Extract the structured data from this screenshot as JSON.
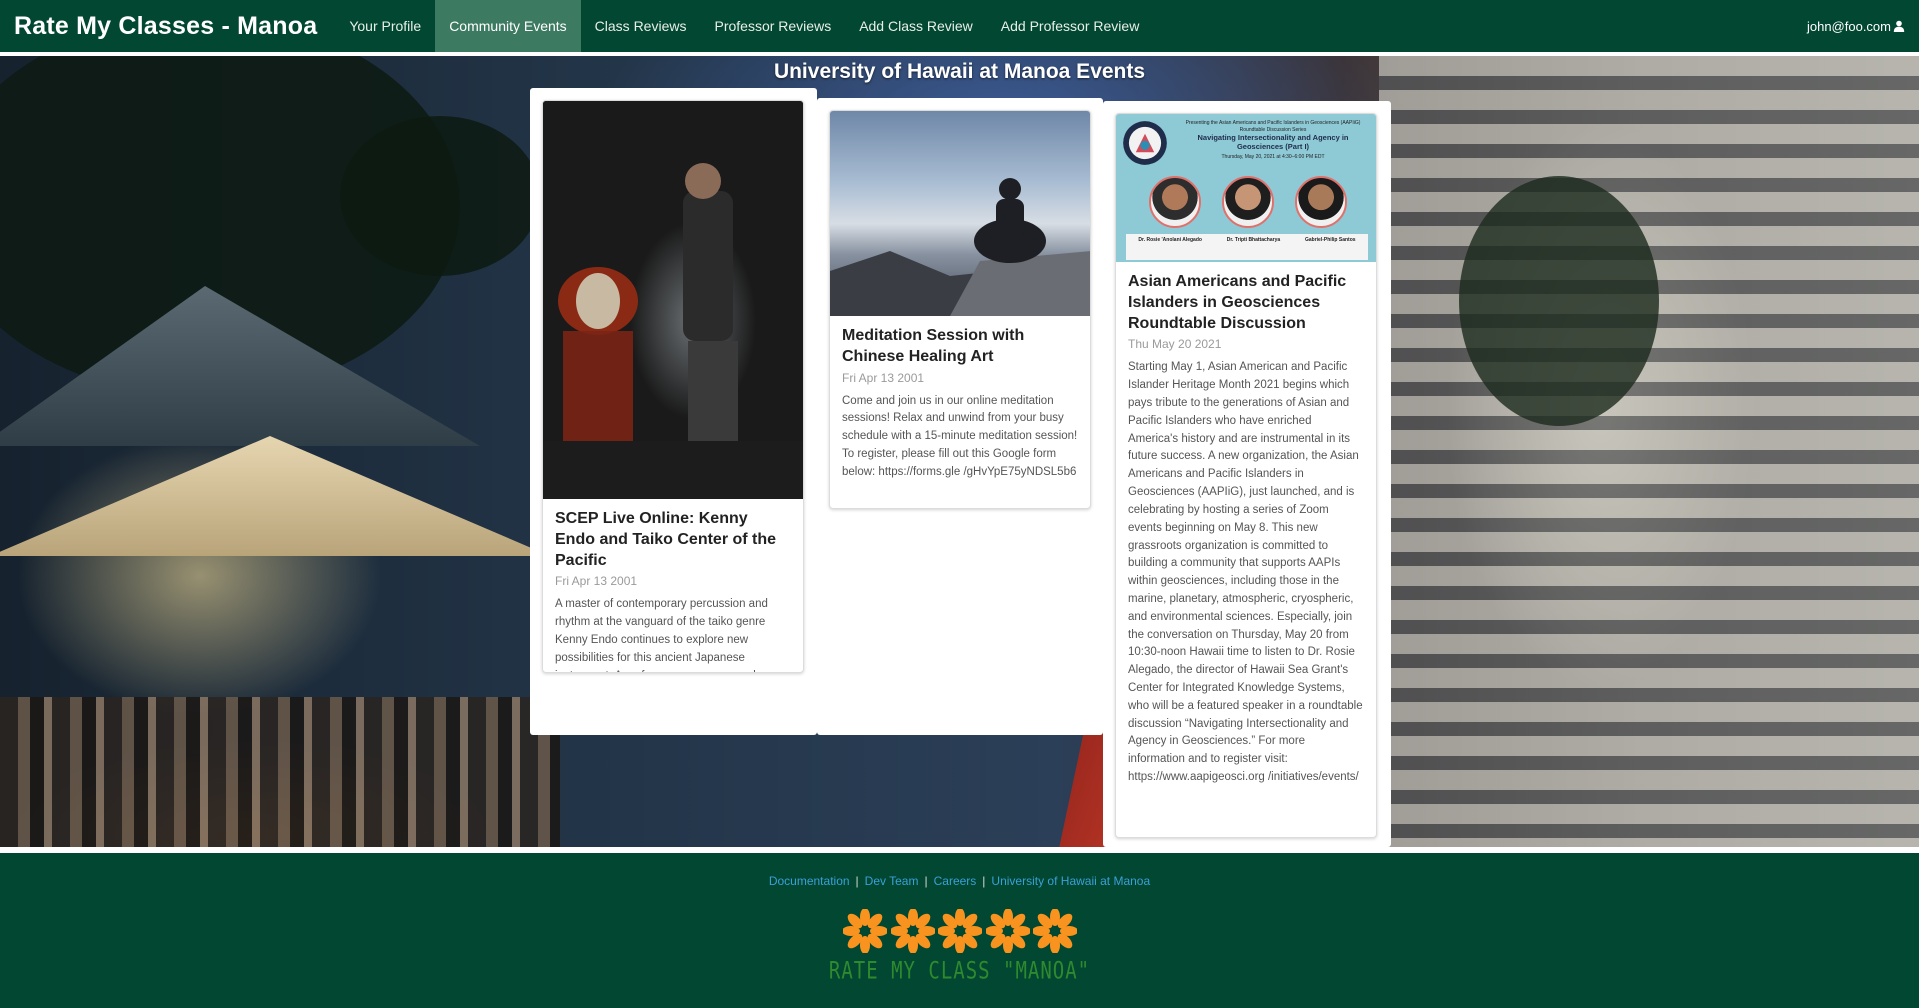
{
  "navbar": {
    "brand": "Rate My Classes - Manoa",
    "links": [
      {
        "label": "Your Profile",
        "active": false
      },
      {
        "label": "Community Events",
        "active": true
      },
      {
        "label": "Class Reviews",
        "active": false
      },
      {
        "label": "Professor Reviews",
        "active": false
      },
      {
        "label": "Add Class Review",
        "active": false
      },
      {
        "label": "Add Professor Review",
        "active": false
      }
    ],
    "user": "john@foo.com",
    "user_icon": "user-icon"
  },
  "hero": {
    "title": "University of Hawaii at Manoa Events"
  },
  "events": [
    {
      "title": "SCEP Live Online: Kenny Endo and Taiko Center of the Pacific",
      "date": "Fri Apr 13 2001",
      "description": "A master of contemporary percussion and rhythm at the vanguard of the taiko genre Kenny Endo continues to explore new possibilities for this ancient Japanese instrument. A performer, composer, and teacher of taiko, he has received numerous awards, accolades, and a natori (a stage name in classical drumming). Kenny is a consummate artist, blending taiko with original music through collaborations with international artists.",
      "image": "taiko-drummer-photo"
    },
    {
      "title": "Meditation Session with Chinese Healing Art",
      "date": "Fri Apr 13 2001",
      "description": "Come and join us in our online meditation sessions! Relax and unwind from your busy schedule with a 15-minute meditation session! To register, please fill out this Google form below: https://forms.gle /gHvYpE75yNDSL5b6",
      "image": "meditation-mountain-photo"
    },
    {
      "title": "Asian Americans and Pacific Islanders in Geosciences Roundtable Discussion",
      "date": "Thu May 20 2021",
      "description": "Starting May 1, Asian American and Pacific Islander Heritage Month 2021 begins which pays tribute to the generations of Asian and Pacific Islanders who have enriched America's history and are instrumental in its future success. A new organization, the Asian Americans and Pacific Islanders in Geosciences (AAPIiG), just launched, and is celebrating by hosting a series of Zoom events beginning on May 8. This new grassroots organization is committed to building a community that supports AAPIs within geosciences, including those in the marine, planetary, atmospheric, cryospheric, and environmental sciences. Especially, join the conversation on Thursday, May 20 from 10:30-noon Hawaii time to listen to Dr. Rosie Alegado, the director of Hawaii Sea Grant's Center for Integrated Knowledge Systems, who will be a featured speaker in a roundtable discussion “Navigating Intersectionality and Agency in Geosciences.” For more information and to register visit: https://www.aapigeosci.org /initiatives/events/",
      "image": "aapiig-flyer"
    }
  ],
  "flyer": {
    "line1": "Presenting the Asian Americans and Pacific Islanders in Geosciences (AAPIiG) Roundtable Discussion Series",
    "title": "Navigating Intersectionality and Agency in Geosciences (Part I)",
    "when": "Thursday, May 20, 2021 at 4:30–6:00 PM EDT",
    "speakers": [
      "Dr. Rosie 'Anolani Alegado",
      "Dr. Tripti Bhattacharya",
      "Gabriel-Philip Santos"
    ]
  },
  "footer": {
    "links": [
      "Documentation",
      "Dev Team",
      "Careers",
      "University of Hawaii at Manoa"
    ],
    "logo_text": "RATE MY CLASS \"MANOA\"",
    "flower_color": "#f7931e",
    "background": "#024731"
  }
}
